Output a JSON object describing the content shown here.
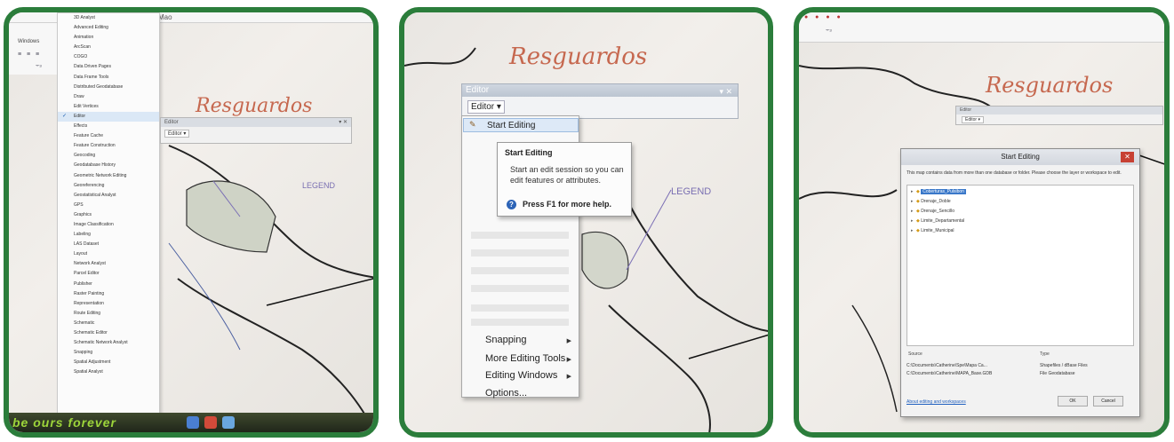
{
  "panel1": {
    "window_title": "Mao",
    "menu_label": "Windows",
    "toolbar_text": "≡ ≡ ≡",
    "toolbar_text2": "⨪₃",
    "toolbars": [
      "3D Analyst",
      "Advanced Editing",
      "Animation",
      "ArcScan",
      "COGO",
      "Data Driven Pages",
      "Data Frame Tools",
      "Distributed Geodatabase",
      "Draw",
      "Edit Vertices",
      "Editor",
      "Effects",
      "Feature Cache",
      "Feature Construction",
      "Geocoding",
      "Geodatabase History",
      "Geometric Network Editing",
      "Georeferencing",
      "Geostatistical Analyst",
      "GPS",
      "Graphics",
      "Image Classification",
      "Labeling",
      "LAS Dataset",
      "Layout",
      "Network Analyst",
      "Parcel Editor",
      "Publisher",
      "Raster Painting",
      "Representation",
      "Route Editing",
      "Schematic",
      "Schematic Editor",
      "Schematic Network Analyst",
      "Snapping",
      "Spatial Adjustment",
      "Spatial Analyst"
    ],
    "checked_item": "Editor",
    "more_glyph": "▾",
    "editor_title": "Editor",
    "editor_button": "Editor ▾",
    "close_glyph": "▾ ✕",
    "taskbar_slogan": "be ours forever"
  },
  "panel2": {
    "editor_title": "Editor",
    "editor_controls": "▾ ✕",
    "editor_button": "Editor ▾",
    "pen_glyph": "✎",
    "start_editing": "Start Editing",
    "menu_items": [
      "Snapping",
      "More Editing Tools",
      "Editing Windows",
      "Options..."
    ],
    "submenu_arrow": "▶",
    "tooltip": {
      "title": "Start Editing",
      "body": "Start an edit session so you can edit features or attributes.",
      "help_glyph": "?",
      "help": "Press F1 for more help."
    }
  },
  "panel3": {
    "toolbar_glyphs": "● ● ● ●",
    "toolbar_glyphs2": "⨪₃",
    "editor_title": "Editor",
    "editor_button": "Editor ▾",
    "dialog": {
      "title": "Start Editing",
      "close": "✕",
      "expand_glyph": "▸",
      "db_glyph": "◆",
      "message": "This map contains data from more than one database or folder. Please choose the layer or workspace to edit.",
      "layers": [
        "Coberturas_Pulsibon",
        "Drenaje_Doble",
        "Drenaje_Sencillo",
        "Limite_Departamental",
        "Limite_Municipal"
      ],
      "source_header": "Source",
      "type_header": "Type",
      "sources": [
        {
          "path": "C:\\Documents\\Catherine\\Spe\\Mapa Ca...",
          "type": "Shapefiles / dBase Files"
        },
        {
          "path": "C:\\Documents\\Catherine\\MAPA_Base.GDB",
          "type": "File Geodatabase"
        }
      ],
      "link": "About editing and workspaces",
      "ok": "OK",
      "cancel": "Cancel"
    }
  },
  "map_labels": {
    "title": "Resguardos",
    "legend": "LEGEND"
  }
}
